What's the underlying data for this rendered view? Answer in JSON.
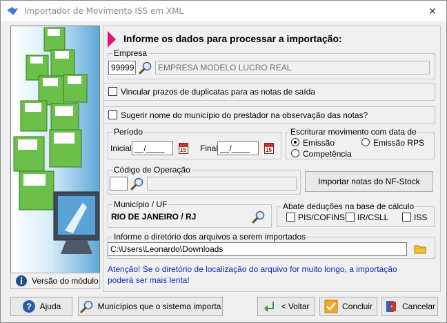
{
  "window": {
    "title": "Importador de Movimento ISS em XML",
    "close_glyph": "✕"
  },
  "header": {
    "text": "Informe os dados para processar a importação:"
  },
  "empresa": {
    "legend": "Empresa",
    "code": "99999",
    "name": "EMPRESA MODELO LUCRO REAL"
  },
  "options": {
    "vincular_label": "Vincular prazos de duplicatas para as notas de saída",
    "sugerir_label": "Sugerir nome do município do prestador na observação das notas?"
  },
  "periodo": {
    "legend": "Período",
    "inicial_label": "Inicial",
    "inicial_value": "__/____",
    "final_label": "Final",
    "final_value": "__/____",
    "calendar_glyph": "15"
  },
  "escriturar": {
    "legend": "Escriturar movimento com data de",
    "emissao": "Emissão",
    "emissao_rps": "Emissão RPS",
    "competencia": "Competência"
  },
  "codigo_operacao": {
    "legend": "Código de Operação",
    "code": "",
    "description": ""
  },
  "importar_button": "Importar notas do NF-Stock",
  "municipio": {
    "legend": "Município / UF",
    "value": "RIO DE JANEIRO / RJ"
  },
  "abate": {
    "legend": "Abate deduções na base de cálculo",
    "pis_cofins": "PIS/COFINS",
    "ir_csll": "IR/CSLL",
    "iss": "ISS"
  },
  "diretorio": {
    "legend": "Informe o diretório dos arquivos a serem importados",
    "path": "C:\\Users\\Leonardo\\Downloads"
  },
  "warning": "Atenção! Se o diretório de localização do arquivo for muito longo, a importação poderá ser mais lenta!",
  "versao_button": "Versão do módulo",
  "footer": {
    "ajuda": "Ajuda",
    "municipios": "Municípios que o sistema importa",
    "voltar": "< Voltar",
    "concluir": "Concluir",
    "cancelar": "Cancelar"
  },
  "colors": {
    "accent_arrow": "#e0177a",
    "warning_text": "#0a2fb5",
    "banner_blue": "#5fa8d8",
    "floppy_green": "#6cc04a"
  },
  "icons": [
    "app-icon",
    "close-icon",
    "search-icon",
    "calendar-icon",
    "folder-icon",
    "help-icon",
    "back-arrow-icon",
    "check-icon",
    "exit-door-icon",
    "info-icon"
  ]
}
